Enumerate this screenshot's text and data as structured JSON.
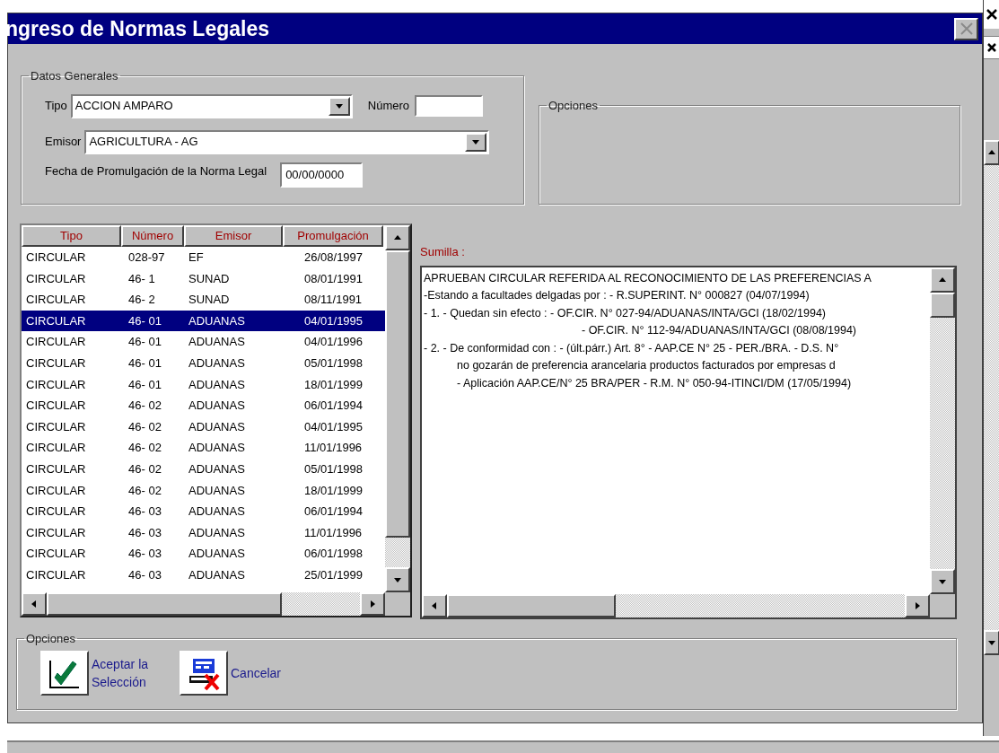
{
  "dialog": {
    "title": "ngreso de Normas Legales",
    "close_disabled": true
  },
  "datos_generales": {
    "legend": "Datos Generales",
    "tipo": {
      "label": "Tipo",
      "value": "ACCION AMPARO"
    },
    "numero": {
      "label": "Número"
    },
    "emisor": {
      "label": "Emisor",
      "value": "AGRICULTURA - AG"
    },
    "fecha": {
      "label": "Fecha de Promulgación de la Norma Legal",
      "value": "00/00/0000"
    }
  },
  "opciones_top": {
    "legend": "Opciones"
  },
  "table": {
    "columns": [
      "Tipo",
      "Número",
      "Emisor",
      "Promulgación"
    ],
    "rows": [
      {
        "cells": [
          "CIRCULAR",
          "028-97",
          "EF",
          "26/08/1997"
        ],
        "selected": false
      },
      {
        "cells": [
          "CIRCULAR",
          "46- 1",
          "SUNAD",
          "08/01/1991"
        ],
        "selected": false
      },
      {
        "cells": [
          "CIRCULAR",
          "46- 2",
          "SUNAD",
          "08/11/1991"
        ],
        "selected": false
      },
      {
        "cells": [
          "CIRCULAR",
          "46- 01",
          "ADUANAS",
          "04/01/1995"
        ],
        "selected": true
      },
      {
        "cells": [
          "CIRCULAR",
          "46- 01",
          "ADUANAS",
          "04/01/1996"
        ],
        "selected": false
      },
      {
        "cells": [
          "CIRCULAR",
          "46- 01",
          "ADUANAS",
          "05/01/1998"
        ],
        "selected": false
      },
      {
        "cells": [
          "CIRCULAR",
          "46- 01",
          "ADUANAS",
          "18/01/1999"
        ],
        "selected": false
      },
      {
        "cells": [
          "CIRCULAR",
          "46- 02",
          "ADUANAS",
          "06/01/1994"
        ],
        "selected": false
      },
      {
        "cells": [
          "CIRCULAR",
          "46- 02",
          "ADUANAS",
          "04/01/1995"
        ],
        "selected": false
      },
      {
        "cells": [
          "CIRCULAR",
          "46- 02",
          "ADUANAS",
          "11/01/1996"
        ],
        "selected": false
      },
      {
        "cells": [
          "CIRCULAR",
          "46- 02",
          "ADUANAS",
          "05/01/1998"
        ],
        "selected": false
      },
      {
        "cells": [
          "CIRCULAR",
          "46- 02",
          "ADUANAS",
          "18/01/1999"
        ],
        "selected": false
      },
      {
        "cells": [
          "CIRCULAR",
          "46- 03",
          "ADUANAS",
          "06/01/1994"
        ],
        "selected": false
      },
      {
        "cells": [
          "CIRCULAR",
          "46- 03",
          "ADUANAS",
          "11/01/1996"
        ],
        "selected": false
      },
      {
        "cells": [
          "CIRCULAR",
          "46- 03",
          "ADUANAS",
          "06/01/1998"
        ],
        "selected": false
      },
      {
        "cells": [
          "CIRCULAR",
          "46- 03",
          "ADUANAS",
          "25/01/1999"
        ],
        "selected": false
      }
    ]
  },
  "sumilla": {
    "label": "Sumilla :",
    "lines": [
      {
        "kind": "main",
        "text": "APRUEBAN CIRCULAR REFERIDA AL RECONOCIMIENTO DE LAS PREFERENCIAS A"
      },
      {
        "kind": "main",
        "text": "-Estando a facultades delgadas por : - R.SUPERINT. N° 000827 (04/07/1994)"
      },
      {
        "kind": "main",
        "text": "- 1. - Quedan sin efecto : - OF.CIR. N° 027-94/ADUANAS/INTA/GCI (18/02/1994)"
      },
      {
        "kind": "aligned",
        "text": "- OF.CIR. N° 112-94/ADUANAS/INTA/GCI (08/08/1994)"
      },
      {
        "kind": "main",
        "text": "- 2. - De conformidad con : - (últ.párr.) Art. 8° - AAP.CE N° 25 - PER./BRA. - D.S. N°"
      },
      {
        "kind": "indented",
        "text": "no gozarán de preferencia arancelaria productos facturados por empresas d"
      },
      {
        "kind": "indented",
        "text": "- Aplicación AAP.CE/N° 25 BRA/PER - R.M. N° 050-94-ITINCI/DM (17/05/1994)"
      }
    ]
  },
  "opciones_bottom": {
    "legend": "Opciones",
    "buttons": [
      {
        "kind": "accept",
        "label": "Aceptar la Selección"
      },
      {
        "kind": "cancel",
        "label": "Cancelar"
      }
    ]
  }
}
